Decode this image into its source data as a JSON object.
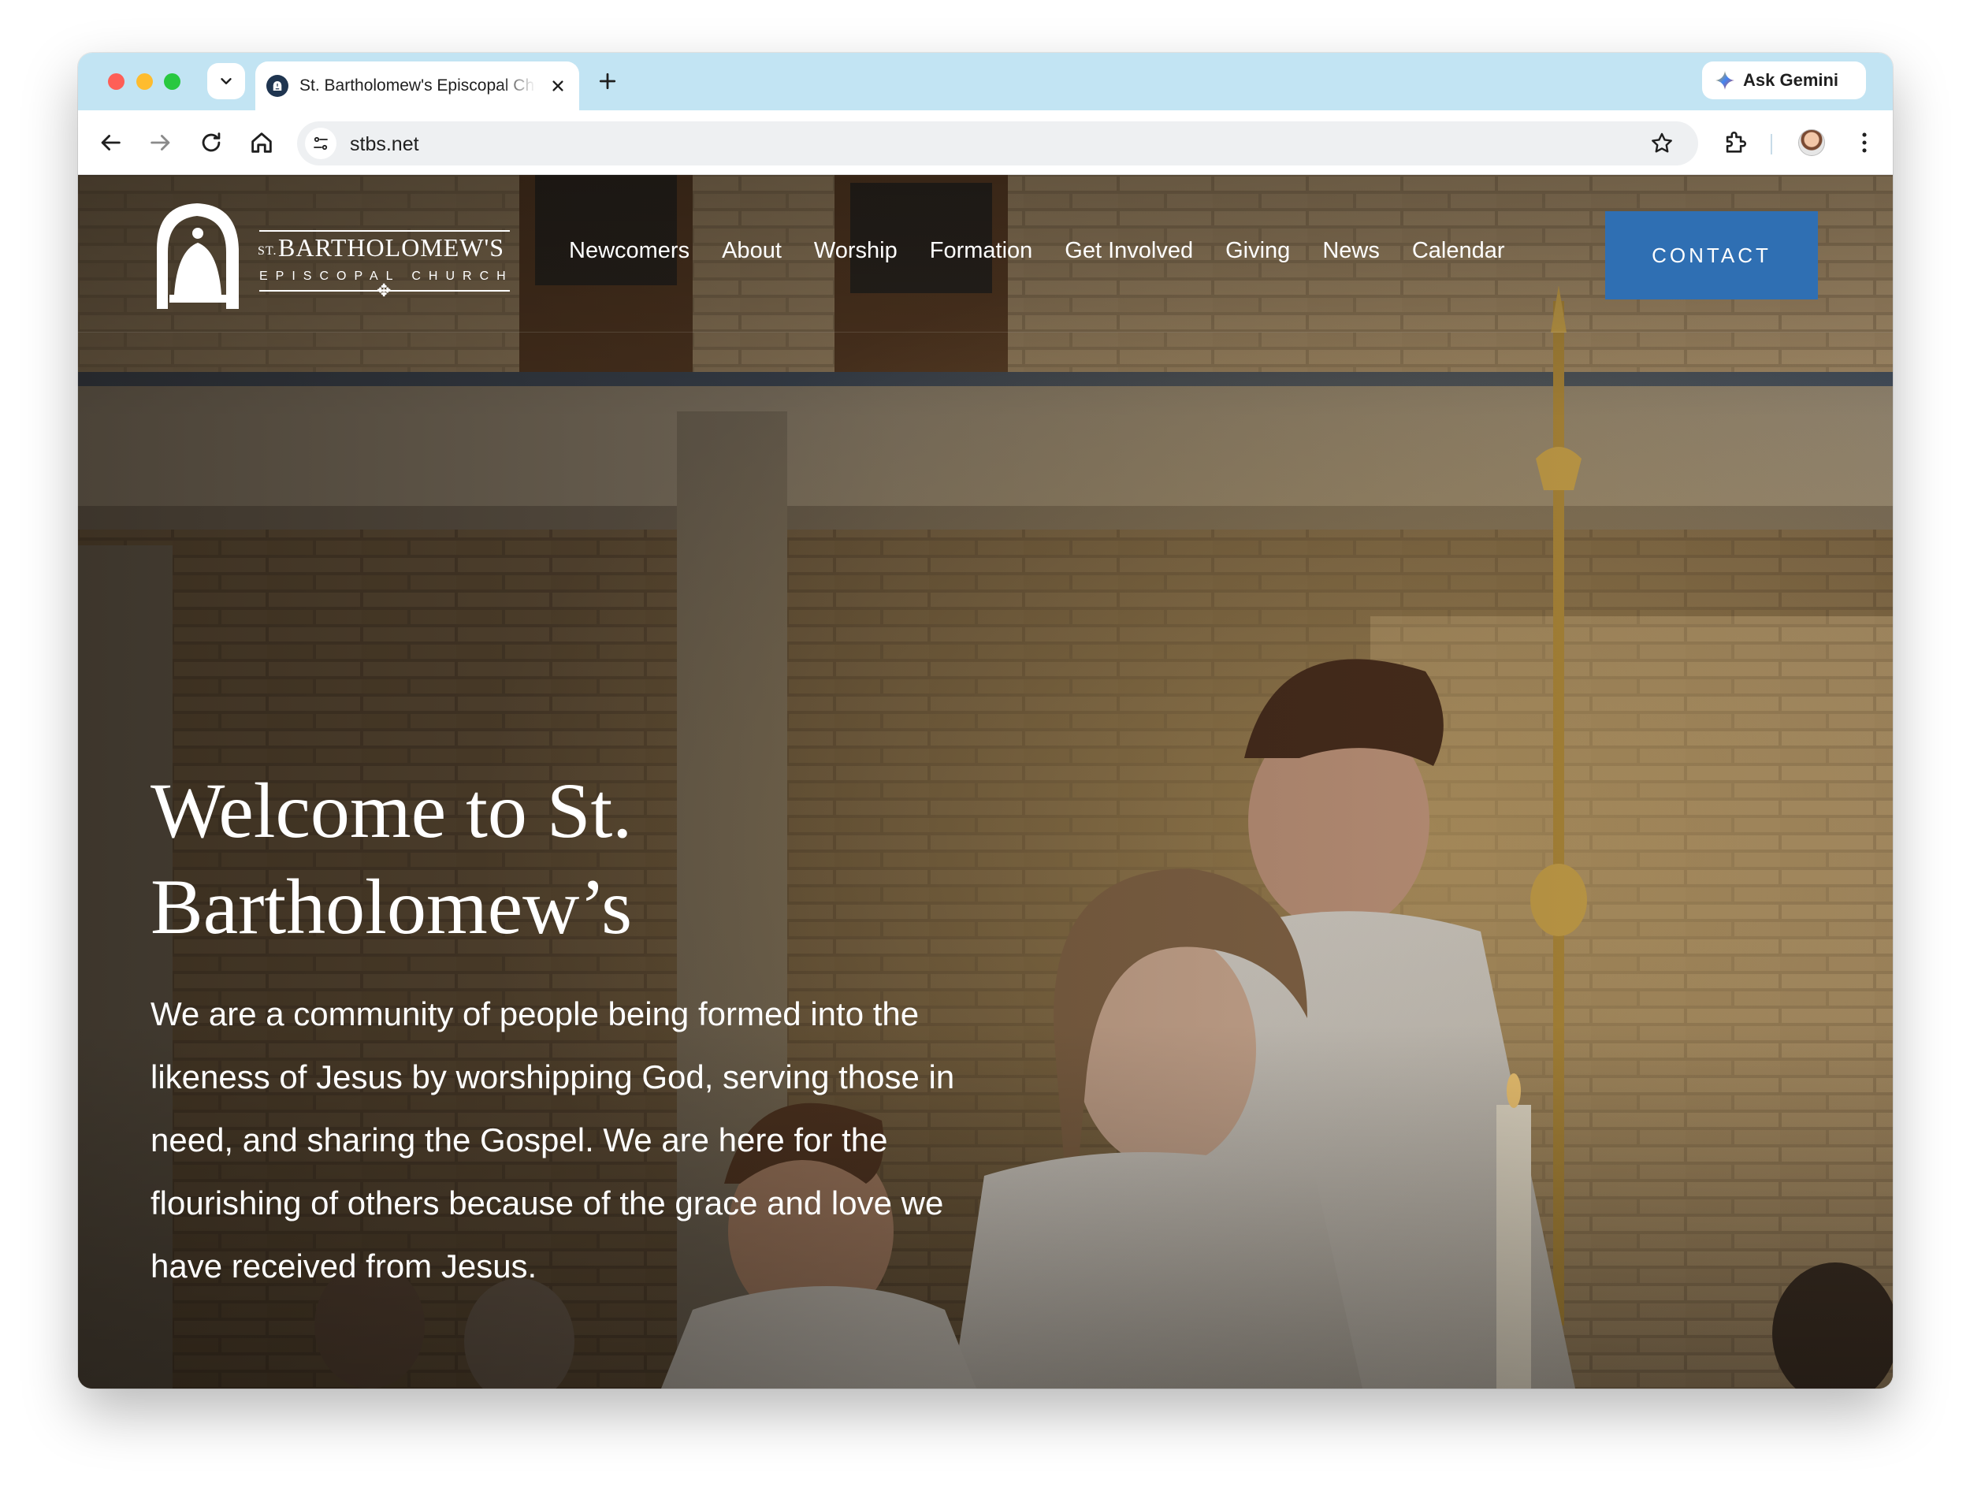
{
  "browser": {
    "tab_title": "St. Bartholomew's Episcopal Church",
    "url": "stbs.net",
    "gemini_label": "Ask Gemini"
  },
  "site": {
    "logo": {
      "st": "ST.",
      "name": "BARTHOLOMEW'S",
      "subtitle": "EPISCOPAL CHURCH"
    },
    "nav": [
      {
        "label": "Newcomers"
      },
      {
        "label": "About"
      },
      {
        "label": "Worship"
      },
      {
        "label": "Formation"
      },
      {
        "label": "Get Involved"
      },
      {
        "label": "Giving"
      },
      {
        "label": "News"
      },
      {
        "label": "Calendar"
      }
    ],
    "contact_label": "CONTACT",
    "accent_color": "#2f6fb3"
  },
  "hero": {
    "title": "Welcome to St. Bartholomew’s",
    "text": "We are a community of people being formed into the likeness of Jesus by worshipping God, serving those in need, and sharing the Gospel. We are here for the flourishing of others because of the grace and love we have received from Jesus."
  }
}
